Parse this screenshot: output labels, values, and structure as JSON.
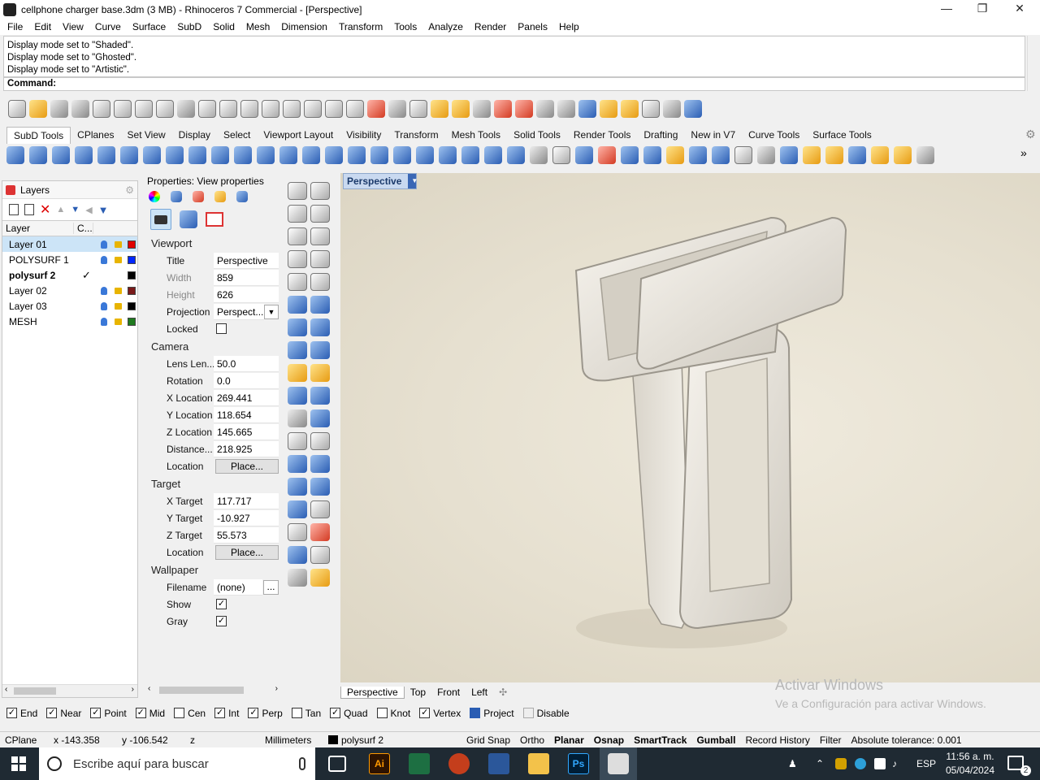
{
  "window": {
    "title": "cellphone charger base.3dm (3 MB) - Rhinoceros 7 Commercial - [Perspective]",
    "minimize": "—",
    "maximize": "❐",
    "close": "✕"
  },
  "menu": [
    "File",
    "Edit",
    "View",
    "Curve",
    "Surface",
    "SubD",
    "Solid",
    "Mesh",
    "Dimension",
    "Transform",
    "Tools",
    "Analyze",
    "Render",
    "Panels",
    "Help"
  ],
  "command_history": [
    "Display mode set to \"Shaded\".",
    "Display mode set to \"Ghosted\".",
    "Display mode set to \"Artistic\"."
  ],
  "command_prompt": "Command:",
  "toolbar_tabs": [
    "SubD Tools",
    "CPlanes",
    "Set View",
    "Display",
    "Select",
    "Viewport Layout",
    "Visibility",
    "Transform",
    "Mesh Tools",
    "Solid Tools",
    "Render Tools",
    "Drafting",
    "New in V7",
    "Curve Tools",
    "Surface Tools"
  ],
  "layers_panel": {
    "title": "Layers",
    "col_layer": "Layer",
    "col_c": "C...",
    "rows": [
      {
        "name": "Layer 01",
        "color": "#e00000",
        "selected": true,
        "current": false
      },
      {
        "name": "POLYSURF 1",
        "color": "#0026ff",
        "selected": false,
        "current": false
      },
      {
        "name": "polysurf 2",
        "color": "#000000",
        "selected": false,
        "current": true
      },
      {
        "name": "Layer 02",
        "color": "#7a1a1a",
        "selected": false,
        "current": false
      },
      {
        "name": "Layer 03",
        "color": "#000000",
        "selected": false,
        "current": false
      },
      {
        "name": "MESH",
        "color": "#1e7a1e",
        "selected": false,
        "current": false
      }
    ],
    "current_mark": "✓"
  },
  "properties": {
    "header": "Properties: View properties",
    "viewport_section": "Viewport",
    "title_label": "Title",
    "title_value": "Perspective",
    "width_label": "Width",
    "width_value": "859",
    "height_label": "Height",
    "height_value": "626",
    "projection_label": "Projection",
    "projection_value": "Perspect...",
    "locked_label": "Locked",
    "camera_section": "Camera",
    "lens_label": "Lens Len...",
    "lens_value": "50.0",
    "rotation_label": "Rotation",
    "rotation_value": "0.0",
    "xloc_label": "X Location",
    "xloc_value": "269.441",
    "yloc_label": "Y Location",
    "yloc_value": "118.654",
    "zloc_label": "Z Location",
    "zloc_value": "145.665",
    "distance_label": "Distance...",
    "distance_value": "218.925",
    "location_label": "Location",
    "place_button": "Place...",
    "target_section": "Target",
    "xt_label": "X Target",
    "xt_value": "117.717",
    "yt_label": "Y Target",
    "yt_value": "-10.927",
    "zt_label": "Z Target",
    "zt_value": "55.573",
    "tlocation_label": "Location",
    "tplace_button": "Place...",
    "wallpaper_section": "Wallpaper",
    "filename_label": "Filename",
    "filename_value": "(none)",
    "browse_button": "...",
    "show_label": "Show",
    "gray_label": "Gray",
    "check": "✓"
  },
  "viewport": {
    "active_tab": "Perspective",
    "tabs": [
      "Perspective",
      "Top",
      "Front",
      "Left"
    ],
    "add_tab": "✣"
  },
  "watermark": {
    "line1": "Activar Windows",
    "line2": "Ve a Configuración para activar Windows."
  },
  "osnap": [
    {
      "label": "End",
      "checked": true
    },
    {
      "label": "Near",
      "checked": true
    },
    {
      "label": "Point",
      "checked": true
    },
    {
      "label": "Mid",
      "checked": true
    },
    {
      "label": "Cen",
      "checked": false
    },
    {
      "label": "Int",
      "checked": true
    },
    {
      "label": "Perp",
      "checked": true
    },
    {
      "label": "Tan",
      "checked": false
    },
    {
      "label": "Quad",
      "checked": true
    },
    {
      "label": "Knot",
      "checked": false
    },
    {
      "label": "Vertex",
      "checked": true
    },
    {
      "label": "Project",
      "checked": true
    },
    {
      "label": "Disable",
      "checked": false
    }
  ],
  "status": {
    "cplane": "CPlane",
    "x": "x -143.358",
    "y": "y -106.542",
    "z": "z",
    "units": "Millimeters",
    "layer": "polysurf 2",
    "grid_snap": "Grid Snap",
    "ortho": "Ortho",
    "planar": "Planar",
    "osnap": "Osnap",
    "smarttrack": "SmartTrack",
    "gumball": "Gumball",
    "record_history": "Record History",
    "filter": "Filter",
    "tolerance": "Absolute tolerance: 0.001"
  },
  "taskbar": {
    "search_placeholder": "Escribe aquí para buscar",
    "ai": "Ai",
    "ps": "Ps",
    "lang": "ESP",
    "time": "11:56 a. m.",
    "date": "05/04/2024",
    "notif": "2"
  }
}
